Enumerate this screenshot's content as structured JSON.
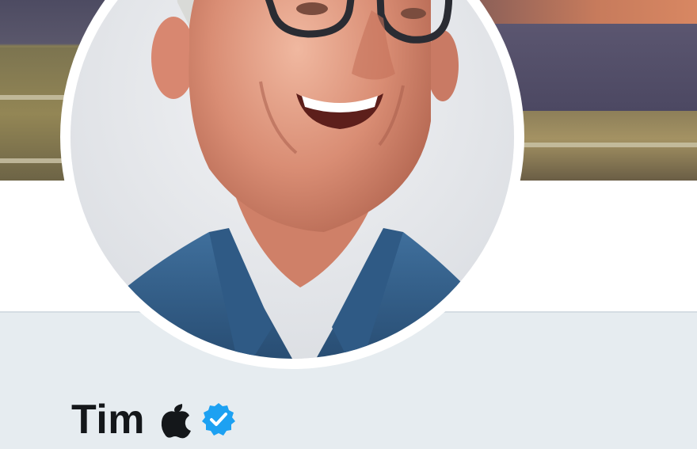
{
  "profile": {
    "name": "Tim",
    "name_icon": "apple-logo-icon",
    "verified": true,
    "verified_icon": "verified-badge-icon",
    "avatar": "profile-photo"
  },
  "colors": {
    "page_background": "#e6ecf0",
    "header_band": "#ffffff",
    "name_text": "#14171a",
    "verified_badge": "#1da1f2"
  }
}
